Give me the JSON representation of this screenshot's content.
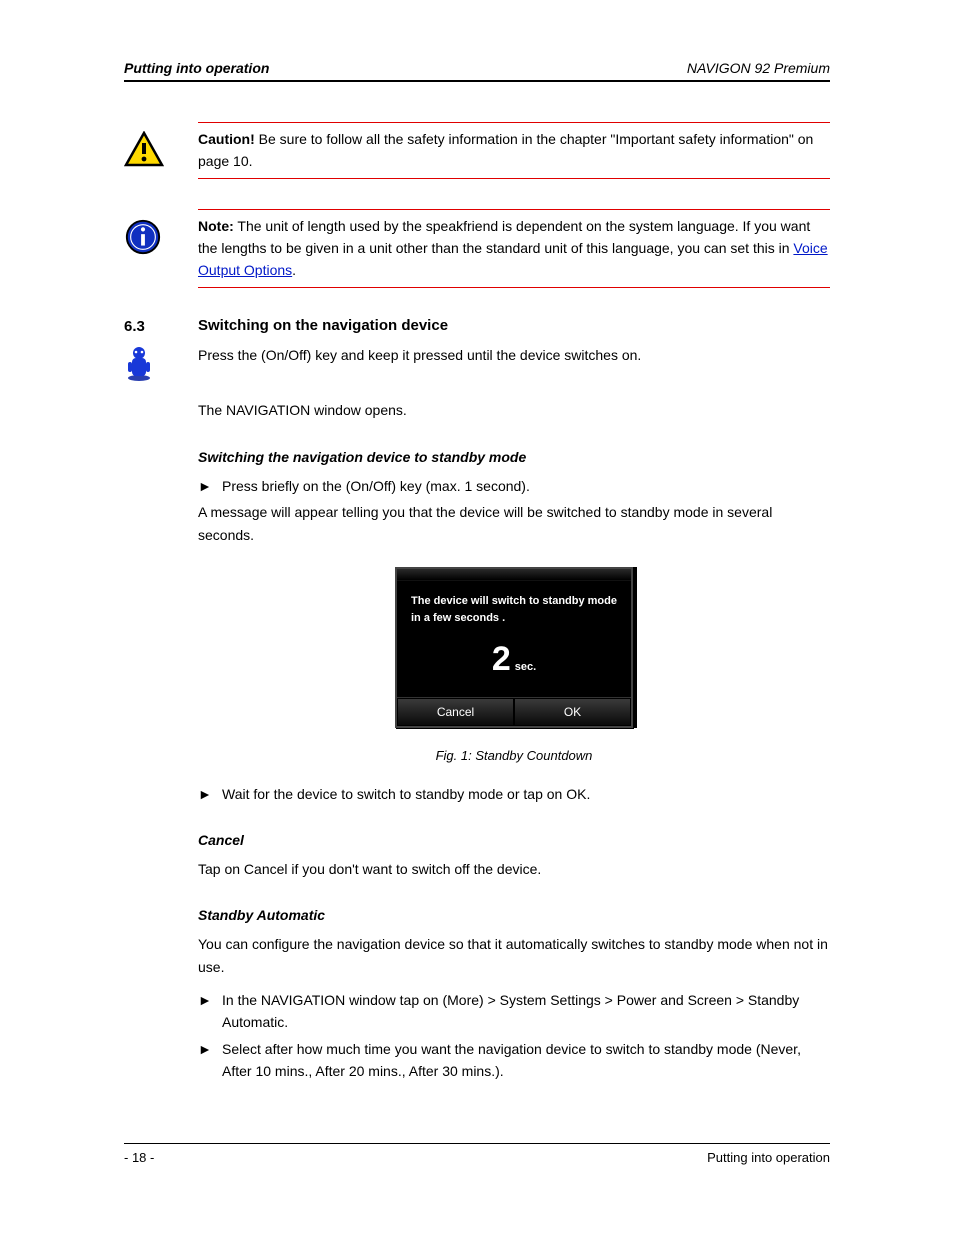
{
  "header": {
    "left": "Putting into operation",
    "right": "NAVIGON 92 Premium"
  },
  "caution": {
    "label": "Caution!",
    "text": "Be sure to follow all the safety information in the chapter",
    "refTitle": "\"Important safety information\"",
    "refPage": "on page 10."
  },
  "note": {
    "label": "Note:",
    "text1": "The unit of length used by the speakfriend is dependent on the system language. If you want the lengths to be given in a unit other than the standard unit of this language, you can set this in",
    "link": "Voice Output Options",
    "tail": "."
  },
  "section": {
    "number": "6.3",
    "title": "Switching on the navigation device",
    "intro": "Press the (On/Off) key and keep it pressed until the device switches on.",
    "after": "The NAVIGATION window opens."
  },
  "standby": {
    "heading": "Switching the navigation device to standby mode",
    "bullet": "Press briefly on the (On/Off) key (max. 1 second).",
    "msg": "A message will appear telling you that the device will be switched to standby mode in several seconds."
  },
  "dialog": {
    "line1": "The device will switch to standby mode",
    "line2": "in a  few seconds .",
    "count": "2",
    "unit": "sec.",
    "cancel": "Cancel",
    "ok": "OK"
  },
  "figcaption": "Fig. 1: Standby Countdown",
  "afterdialog": {
    "bullet": "Wait for the device to switch to standby mode or tap on OK.",
    "cancelTitle": "Cancel",
    "cancelText": "Tap on Cancel if you don't want to switch off the device."
  },
  "autostandby": {
    "title": "Standby Automatic",
    "text": "You can configure the navigation device so that it automatically switches to standby mode when not in use.",
    "bullet1": "In the NAVIGATION window tap on (More) > System Settings > Power and Screen > Standby Automatic.",
    "bullet2": "Select after how much time you want the navigation device to switch to standby mode (Never, After 10 mins., After 20 mins., After 30 mins.)."
  },
  "footer": {
    "left": "- 18 -",
    "right": "Putting into operation"
  }
}
